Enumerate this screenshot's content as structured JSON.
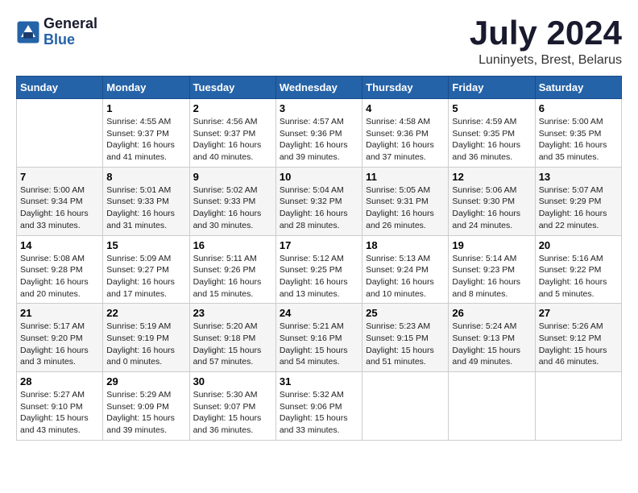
{
  "logo": {
    "line1": "General",
    "line2": "Blue"
  },
  "title": "July 2024",
  "subtitle": "Luninyets, Brest, Belarus",
  "headers": [
    "Sunday",
    "Monday",
    "Tuesday",
    "Wednesday",
    "Thursday",
    "Friday",
    "Saturday"
  ],
  "weeks": [
    [
      {
        "day": "",
        "info": ""
      },
      {
        "day": "1",
        "info": "Sunrise: 4:55 AM\nSunset: 9:37 PM\nDaylight: 16 hours\nand 41 minutes."
      },
      {
        "day": "2",
        "info": "Sunrise: 4:56 AM\nSunset: 9:37 PM\nDaylight: 16 hours\nand 40 minutes."
      },
      {
        "day": "3",
        "info": "Sunrise: 4:57 AM\nSunset: 9:36 PM\nDaylight: 16 hours\nand 39 minutes."
      },
      {
        "day": "4",
        "info": "Sunrise: 4:58 AM\nSunset: 9:36 PM\nDaylight: 16 hours\nand 37 minutes."
      },
      {
        "day": "5",
        "info": "Sunrise: 4:59 AM\nSunset: 9:35 PM\nDaylight: 16 hours\nand 36 minutes."
      },
      {
        "day": "6",
        "info": "Sunrise: 5:00 AM\nSunset: 9:35 PM\nDaylight: 16 hours\nand 35 minutes."
      }
    ],
    [
      {
        "day": "7",
        "info": "Sunrise: 5:00 AM\nSunset: 9:34 PM\nDaylight: 16 hours\nand 33 minutes."
      },
      {
        "day": "8",
        "info": "Sunrise: 5:01 AM\nSunset: 9:33 PM\nDaylight: 16 hours\nand 31 minutes."
      },
      {
        "day": "9",
        "info": "Sunrise: 5:02 AM\nSunset: 9:33 PM\nDaylight: 16 hours\nand 30 minutes."
      },
      {
        "day": "10",
        "info": "Sunrise: 5:04 AM\nSunset: 9:32 PM\nDaylight: 16 hours\nand 28 minutes."
      },
      {
        "day": "11",
        "info": "Sunrise: 5:05 AM\nSunset: 9:31 PM\nDaylight: 16 hours\nand 26 minutes."
      },
      {
        "day": "12",
        "info": "Sunrise: 5:06 AM\nSunset: 9:30 PM\nDaylight: 16 hours\nand 24 minutes."
      },
      {
        "day": "13",
        "info": "Sunrise: 5:07 AM\nSunset: 9:29 PM\nDaylight: 16 hours\nand 22 minutes."
      }
    ],
    [
      {
        "day": "14",
        "info": "Sunrise: 5:08 AM\nSunset: 9:28 PM\nDaylight: 16 hours\nand 20 minutes."
      },
      {
        "day": "15",
        "info": "Sunrise: 5:09 AM\nSunset: 9:27 PM\nDaylight: 16 hours\nand 17 minutes."
      },
      {
        "day": "16",
        "info": "Sunrise: 5:11 AM\nSunset: 9:26 PM\nDaylight: 16 hours\nand 15 minutes."
      },
      {
        "day": "17",
        "info": "Sunrise: 5:12 AM\nSunset: 9:25 PM\nDaylight: 16 hours\nand 13 minutes."
      },
      {
        "day": "18",
        "info": "Sunrise: 5:13 AM\nSunset: 9:24 PM\nDaylight: 16 hours\nand 10 minutes."
      },
      {
        "day": "19",
        "info": "Sunrise: 5:14 AM\nSunset: 9:23 PM\nDaylight: 16 hours\nand 8 minutes."
      },
      {
        "day": "20",
        "info": "Sunrise: 5:16 AM\nSunset: 9:22 PM\nDaylight: 16 hours\nand 5 minutes."
      }
    ],
    [
      {
        "day": "21",
        "info": "Sunrise: 5:17 AM\nSunset: 9:20 PM\nDaylight: 16 hours\nand 3 minutes."
      },
      {
        "day": "22",
        "info": "Sunrise: 5:19 AM\nSunset: 9:19 PM\nDaylight: 16 hours\nand 0 minutes."
      },
      {
        "day": "23",
        "info": "Sunrise: 5:20 AM\nSunset: 9:18 PM\nDaylight: 15 hours\nand 57 minutes."
      },
      {
        "day": "24",
        "info": "Sunrise: 5:21 AM\nSunset: 9:16 PM\nDaylight: 15 hours\nand 54 minutes."
      },
      {
        "day": "25",
        "info": "Sunrise: 5:23 AM\nSunset: 9:15 PM\nDaylight: 15 hours\nand 51 minutes."
      },
      {
        "day": "26",
        "info": "Sunrise: 5:24 AM\nSunset: 9:13 PM\nDaylight: 15 hours\nand 49 minutes."
      },
      {
        "day": "27",
        "info": "Sunrise: 5:26 AM\nSunset: 9:12 PM\nDaylight: 15 hours\nand 46 minutes."
      }
    ],
    [
      {
        "day": "28",
        "info": "Sunrise: 5:27 AM\nSunset: 9:10 PM\nDaylight: 15 hours\nand 43 minutes."
      },
      {
        "day": "29",
        "info": "Sunrise: 5:29 AM\nSunset: 9:09 PM\nDaylight: 15 hours\nand 39 minutes."
      },
      {
        "day": "30",
        "info": "Sunrise: 5:30 AM\nSunset: 9:07 PM\nDaylight: 15 hours\nand 36 minutes."
      },
      {
        "day": "31",
        "info": "Sunrise: 5:32 AM\nSunset: 9:06 PM\nDaylight: 15 hours\nand 33 minutes."
      },
      {
        "day": "",
        "info": ""
      },
      {
        "day": "",
        "info": ""
      },
      {
        "day": "",
        "info": ""
      }
    ]
  ]
}
